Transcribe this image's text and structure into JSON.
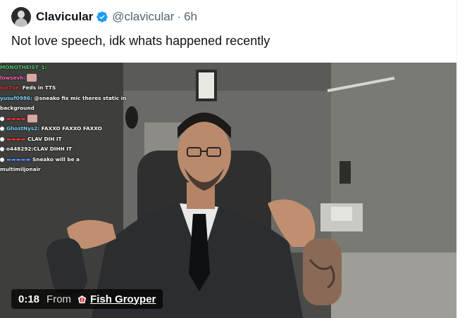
{
  "post": {
    "display_name": "Clavicular",
    "handle": "@clavicular",
    "separator": "·",
    "time": "6h",
    "text": "Not love speech, idk whats happened recently",
    "verified_color": "#1d9bf0"
  },
  "video": {
    "duration": "0:18",
    "from_label": "From",
    "source_name": "Fish Groyper",
    "chat": [
      {
        "user": "MONOTHEIST_1:",
        "msg": ""
      },
      {
        "user": "lowsevh:",
        "msg": ""
      },
      {
        "user": "sin7se:",
        "msg": " Feds in TTS"
      },
      {
        "user": "yusuf0986:",
        "msg": " @sneako fix mic theres static in"
      },
      {
        "user": "",
        "msg": "background"
      },
      {
        "user": "",
        "msg": ""
      },
      {
        "user": "GhostNys2:",
        "msg": " FAXXO FAXXO FAXXO"
      },
      {
        "user": "",
        "msg": " CLAV DIH IT"
      },
      {
        "user": "o448292:",
        "msg": "CLAV DIHH IT"
      },
      {
        "user": "",
        "msg": " Sneako will be a"
      },
      {
        "user": "",
        "msg": "multimiljonair"
      }
    ]
  },
  "icons": {
    "avatar": "profile-avatar",
    "verified": "verified-badge-icon",
    "source": "source-account-icon"
  }
}
